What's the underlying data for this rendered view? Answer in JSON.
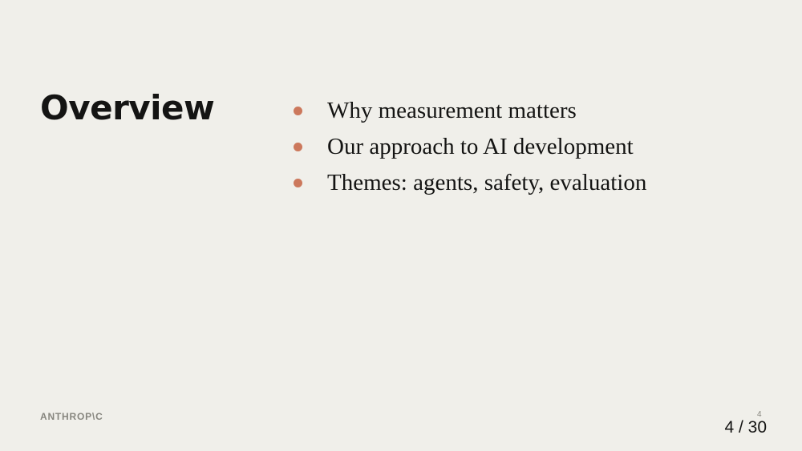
{
  "slide": {
    "title": "Overview",
    "bullets": [
      "Why measurement matters",
      "Our approach to AI development",
      "Themes: agents, safety, evaluation"
    ]
  },
  "footer": {
    "logo": "ANTHROP\\C",
    "page_number": "4",
    "counter": "4 / 30"
  },
  "colors": {
    "bullet": "#cc785c",
    "background": "#f0efea"
  }
}
